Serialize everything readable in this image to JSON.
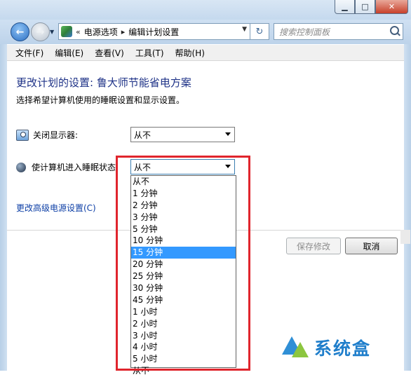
{
  "window": {
    "minimize_glyph": "▁",
    "maximize_glyph": "□",
    "close_glyph": "✕"
  },
  "address": {
    "crumb_sep": "«",
    "crumb1": "电源选项",
    "crumb_arrow": "▸",
    "crumb2": "编辑计划设置",
    "search_placeholder": "搜索控制面板"
  },
  "menu": {
    "file": "文件(F)",
    "edit": "编辑(E)",
    "view": "查看(V)",
    "tools": "工具(T)",
    "help": "帮助(H)"
  },
  "page": {
    "title": "更改计划的设置: 鲁大师节能省电方案",
    "subtitle": "选择希望计算机使用的睡眠设置和显示设置。",
    "display_label": "关闭显示器:",
    "display_value": "从不",
    "sleep_label": "使计算机进入睡眠状态:",
    "sleep_value": "从不",
    "advanced_link": "更改高级电源设置(C)",
    "save_button": "保存修改",
    "cancel_button": "取消"
  },
  "dropdown": {
    "items": [
      "从不",
      "1 分钟",
      "2 分钟",
      "3 分钟",
      "5 分钟",
      "10 分钟",
      "15 分钟",
      "20 分钟",
      "25 分钟",
      "30 分钟",
      "45 分钟",
      "1 小时",
      "2 小时",
      "3 小时",
      "4 小时",
      "5 小时",
      "从不"
    ],
    "selected_index": 6
  },
  "watermark": {
    "text": "系统盒"
  },
  "colors": {
    "heading": "#1e3287",
    "link": "#0d3fa6",
    "selection": "#3399ff",
    "highlight_box": "#e0252d"
  }
}
